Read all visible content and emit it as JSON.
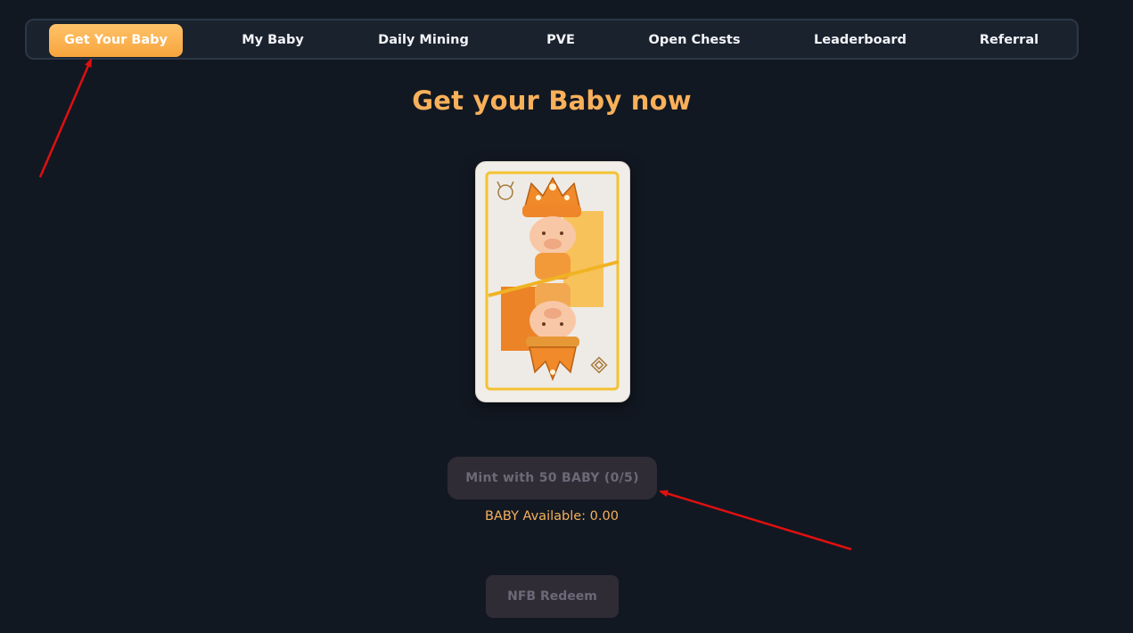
{
  "nav": {
    "items": [
      {
        "label": "Get Your Baby",
        "active": true
      },
      {
        "label": "My Baby",
        "active": false
      },
      {
        "label": "Daily Mining",
        "active": false
      },
      {
        "label": "PVE",
        "active": false
      },
      {
        "label": "Open Chests",
        "active": false
      },
      {
        "label": "Leaderboard",
        "active": false
      },
      {
        "label": "Referral",
        "active": false
      }
    ]
  },
  "main": {
    "title": "Get your Baby now",
    "card_image": "baby-king-card",
    "mint_label": "Mint with 50 BABY (0/5)",
    "available_text": "BABY Available: 0.00",
    "redeem_label": "NFB Redeem"
  },
  "colors": {
    "background": "#121822",
    "accent": "#f9b05a",
    "active_tab": "#f7a43c",
    "disabled_button": "#2f2c36",
    "annotation_arrow": "#e01010"
  }
}
